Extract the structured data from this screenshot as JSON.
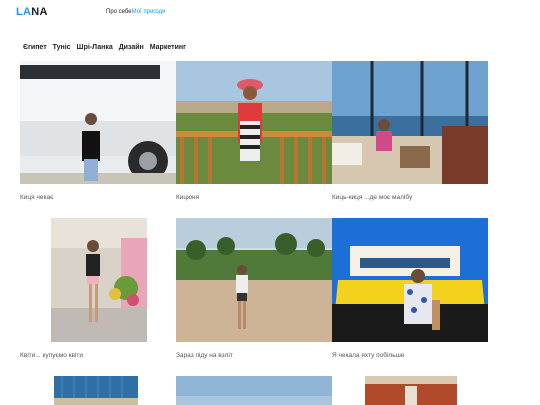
{
  "header": {
    "logo_part1": "LA",
    "logo_part2": "NA",
    "nav": [
      {
        "label": "Про себе",
        "active": false
      },
      {
        "label": "Мої пригоди",
        "active": true
      }
    ]
  },
  "categories": [
    "Єгипет",
    "Туніс",
    "Шрі-Ланка",
    "Дизайн",
    "Маркетинг"
  ],
  "photos": [
    {
      "caption": "Киця чекає"
    },
    {
      "caption": "Кицюня"
    },
    {
      "caption": "Киць-киця ...де моє малібу"
    },
    {
      "caption": "Квіти... купуємо квіти"
    },
    {
      "caption": "Зараз піду на взліт"
    },
    {
      "caption": "Я чекала яхту побільше"
    }
  ],
  "colors": {
    "accent": "#2196f3"
  }
}
